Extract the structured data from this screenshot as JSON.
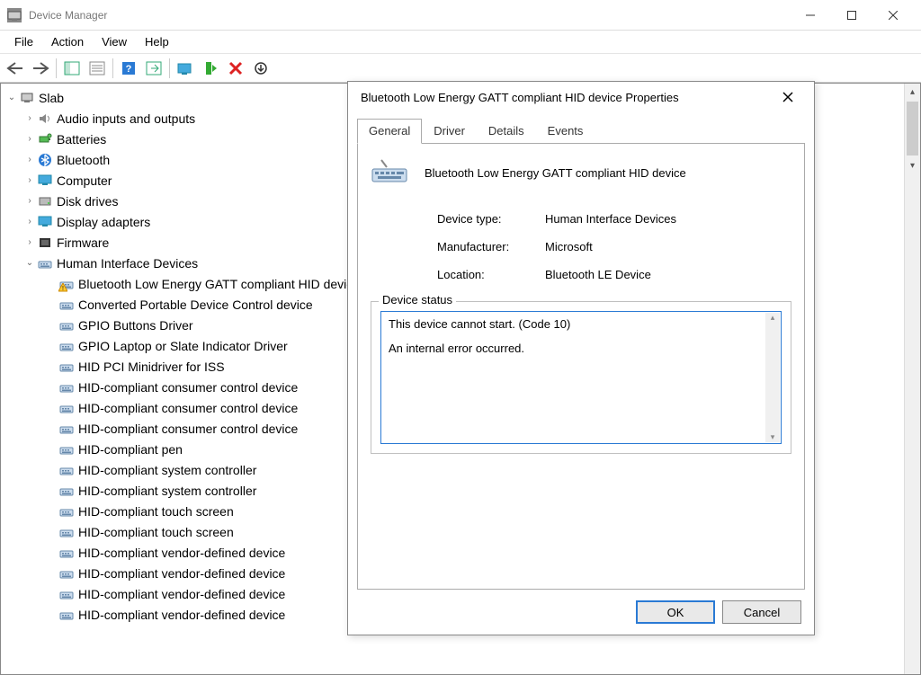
{
  "window": {
    "title": "Device Manager"
  },
  "menu": {
    "file": "File",
    "action": "Action",
    "view": "View",
    "help": "Help"
  },
  "tree": {
    "root": "Slab",
    "categories": [
      {
        "label": "Audio inputs and outputs",
        "expanded": false
      },
      {
        "label": "Batteries",
        "expanded": false
      },
      {
        "label": "Bluetooth",
        "expanded": false
      },
      {
        "label": "Computer",
        "expanded": false
      },
      {
        "label": "Disk drives",
        "expanded": false
      },
      {
        "label": "Display adapters",
        "expanded": false
      },
      {
        "label": "Firmware",
        "expanded": false
      },
      {
        "label": "Human Interface Devices",
        "expanded": true,
        "children": [
          "Bluetooth Low Energy GATT compliant HID device",
          "Converted Portable Device Control device",
          "GPIO Buttons Driver",
          "GPIO Laptop or Slate Indicator Driver",
          "HID PCI Minidriver for ISS",
          "HID-compliant consumer control device",
          "HID-compliant consumer control device",
          "HID-compliant consumer control device",
          "HID-compliant pen",
          "HID-compliant system controller",
          "HID-compliant system controller",
          "HID-compliant touch screen",
          "HID-compliant touch screen",
          "HID-compliant vendor-defined device",
          "HID-compliant vendor-defined device",
          "HID-compliant vendor-defined device",
          "HID-compliant vendor-defined device"
        ]
      }
    ]
  },
  "dialog": {
    "title": "Bluetooth Low Energy GATT compliant HID device Properties",
    "tabs": {
      "general": "General",
      "driver": "Driver",
      "details": "Details",
      "events": "Events"
    },
    "device_name": "Bluetooth Low Energy GATT compliant HID device",
    "labels": {
      "device_type": "Device type:",
      "manufacturer": "Manufacturer:",
      "location": "Location:",
      "device_status": "Device status"
    },
    "values": {
      "device_type": "Human Interface Devices",
      "manufacturer": "Microsoft",
      "location": "Bluetooth LE Device"
    },
    "status_line1": "This device cannot start. (Code 10)",
    "status_line2": "An internal error occurred.",
    "buttons": {
      "ok": "OK",
      "cancel": "Cancel"
    }
  }
}
